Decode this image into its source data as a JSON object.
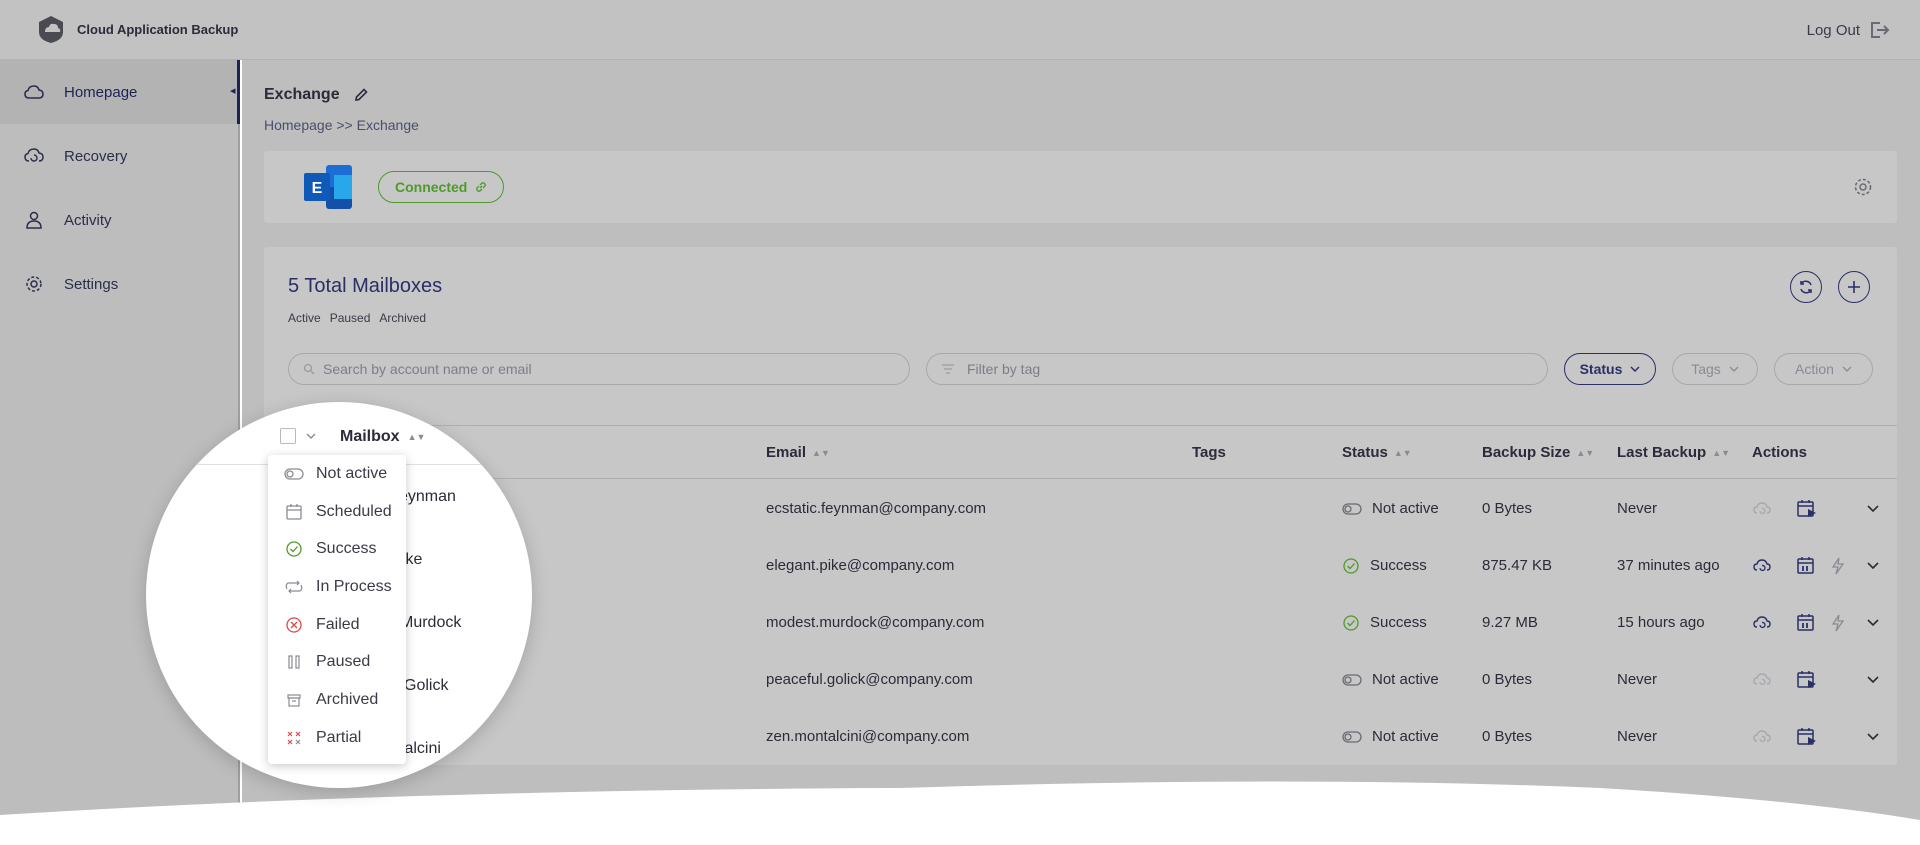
{
  "app": {
    "title": "Cloud Application Backup",
    "logout_label": "Log Out"
  },
  "sidebar": {
    "items": [
      {
        "label": "Homepage",
        "icon": "cloud-icon"
      },
      {
        "label": "Recovery",
        "icon": "cloud-restore-icon"
      },
      {
        "label": "Activity",
        "icon": "user-icon"
      },
      {
        "label": "Settings",
        "icon": "gear-icon"
      }
    ]
  },
  "page": {
    "title": "Exchange",
    "breadcrumb": "Homepage >> Exchange",
    "connection_status": "Connected"
  },
  "mailboxes": {
    "total_label": "5 Total Mailboxes",
    "filter_links": [
      "Active",
      "Paused",
      "Archived"
    ],
    "search_placeholder": "Search by account name or email",
    "tag_placeholder": "Filter by tag",
    "status_button": "Status",
    "tags_button": "Tags",
    "action_button": "Action",
    "columns": {
      "mailbox": "Mailbox",
      "email": "Email",
      "tags": "Tags",
      "status": "Status",
      "backup_size": "Backup Size",
      "last_backup": "Last Backup",
      "actions": "Actions"
    },
    "rows": [
      {
        "name_fragment": "eynman",
        "email": "ecstatic.feynman@company.com",
        "status": "Not active",
        "size": "0 Bytes",
        "last": "Never"
      },
      {
        "name_fragment": "ike",
        "email": "elegant.pike@company.com",
        "status": "Success",
        "size": "875.47 KB",
        "last": "37 minutes ago"
      },
      {
        "name_fragment": "Murdock",
        "email": "modest.murdock@company.com",
        "status": "Success",
        "size": "9.27 MB",
        "last": "15 hours ago"
      },
      {
        "name_fragment": "Golick",
        "email": "peaceful.golick@company.com",
        "status": "Not active",
        "size": "0 Bytes",
        "last": "Never"
      },
      {
        "name_fragment": "talcini",
        "email": "zen.montalcini@company.com",
        "status": "Not active",
        "size": "0 Bytes",
        "last": "Never"
      }
    ]
  },
  "status_dropdown": {
    "items": [
      {
        "label": "Not active",
        "icon": "toggle-off-icon"
      },
      {
        "label": "Scheduled",
        "icon": "calendar-icon"
      },
      {
        "label": "Success",
        "icon": "check-circle-icon"
      },
      {
        "label": "In Process",
        "icon": "sync-icon"
      },
      {
        "label": "Failed",
        "icon": "x-circle-icon"
      },
      {
        "label": "Paused",
        "icon": "pause-icon"
      },
      {
        "label": "Archived",
        "icon": "archive-icon"
      },
      {
        "label": "Partial",
        "icon": "partial-icon"
      }
    ]
  },
  "colors": {
    "accent": "#2a2f66",
    "success": "#4f9a2a",
    "failed": "#d84a4a"
  }
}
